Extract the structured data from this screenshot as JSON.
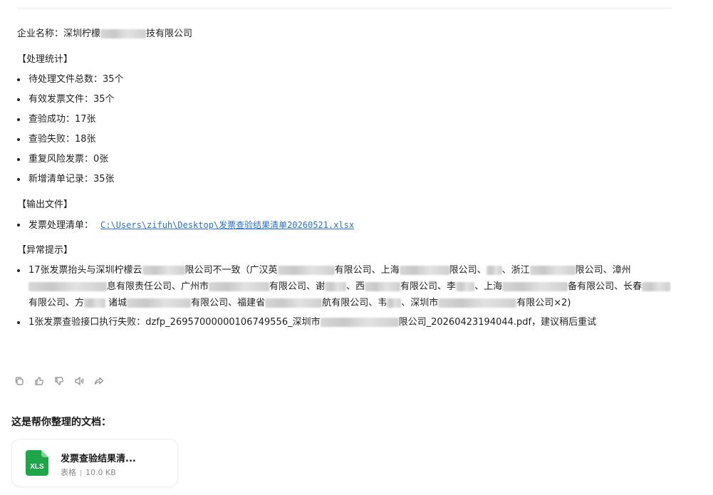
{
  "message": {
    "company": {
      "label": "企业名称：深圳柠檬",
      "suffix": "技有限公司"
    },
    "stats": {
      "title": "【处理统计】",
      "items": [
        "待处理文件总数：35个",
        "有效发票文件：35个",
        "查验成功：17张",
        "查验失败：18张",
        "重复风险发票：0张",
        "新增清单记录：35张"
      ]
    },
    "output": {
      "title": "【输出文件】",
      "label": "发票处理清单：",
      "path": "C:\\Users\\zifuh\\Desktop\\发票查验结果清单20260521.xlsx"
    },
    "anomaly": {
      "title": "【异常提示】",
      "item1": {
        "p1": "17张发票抬头与深圳柠檬云",
        "p2": "限公司不一致（广汉英",
        "p3": "有限公司、上海",
        "p4": "限公司、",
        "p5": "、浙江",
        "p6": "限公司、漳州",
        "p7": "息有限责任公司、广州市",
        "p8": "有限公司、谢",
        "p9": "、西",
        "p10": "有限公司、李",
        "p11": "、上海",
        "p12": "备有限公司、长春",
        "p13": "有限公司、方",
        "p14": "诸城",
        "p15": "有限公司、福建省",
        "p16": "航有限公司、韦",
        "p17": "、深圳市",
        "p18": "有限公司×2)"
      },
      "item2": {
        "p1": "1张发票查验接口执行失败：dzfp_26957000000106749556_深圳市",
        "p2": "限公司_20260423194044.pdf，建议稍后重试"
      }
    }
  },
  "actions": {
    "icons": [
      "copy-icon",
      "thumbs-up-icon",
      "thumbs-down-icon",
      "speaker-icon",
      "share-icon"
    ]
  },
  "documents": {
    "heading": "这是帮你整理的文档：",
    "file": {
      "icon_text": "XLS",
      "name": "发票查验结果清...",
      "type": "表格",
      "size": "10.0 KB",
      "icon_color": "#1fa64a"
    }
  }
}
